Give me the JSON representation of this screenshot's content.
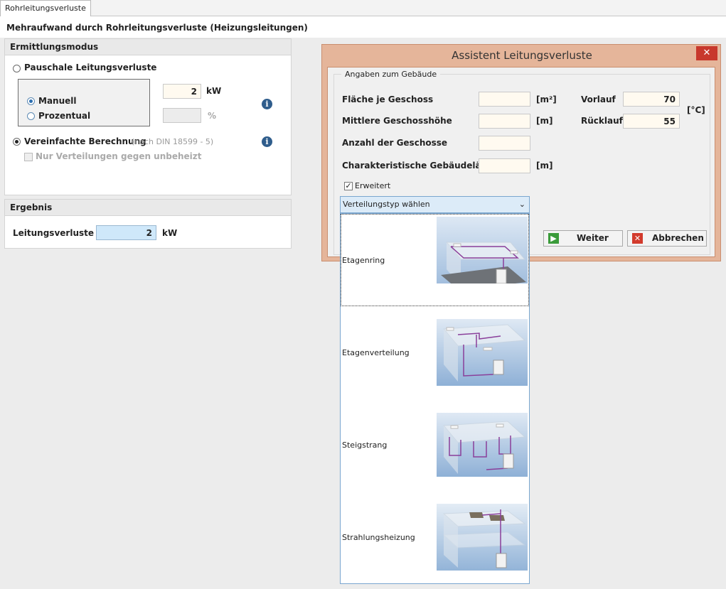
{
  "tab": {
    "label": "Rohrleitungsverluste"
  },
  "headline": "Mehraufwand durch Rohrleitungsverluste (Heizungsleitungen)",
  "mode_group": {
    "title": "Ermittlungsmodus",
    "pauschal_label": "Pauschale Leitungsverluste",
    "manuell_label": "Manuell",
    "prozentual_label": "Prozentual",
    "kw_value": "2",
    "kw_unit": "kW",
    "percent_value": "",
    "percent_unit": "%",
    "vereinfacht_label": "Vereinfachte Berechnung",
    "vereinfacht_note": "(nach DIN 18599 - 5)",
    "nur_verteilungen_label": "Nur Verteilungen gegen unbeheizt"
  },
  "result_group": {
    "title": "Ergebnis",
    "label": "Leitungsverluste",
    "value": "2",
    "unit": "kW"
  },
  "dialog": {
    "title": "Assistent Leitungsverluste",
    "close_glyph": "✕",
    "fieldset_title": "Angaben zum Gebäude",
    "flaeche_label": "Fläche je Geschoss",
    "flaeche_value": "",
    "flaeche_unit": "[m²]",
    "hoehe_label": "Mittlere Geschosshöhe",
    "hoehe_value": "",
    "hoehe_unit": "[m]",
    "anzahl_label": "Anzahl der Geschosse",
    "anzahl_value": "",
    "laenge_label": "Charakteristische Gebäudelänge",
    "laenge_value": "",
    "laenge_unit": "[m]",
    "vorlauf_label": "Vorlauf",
    "vorlauf_value": "70",
    "ruecklauf_label": "Rücklauf",
    "ruecklauf_value": "55",
    "temp_unit": "[°C]",
    "erweitert_label": "Erweitert",
    "erweitert_checked": true,
    "combo_text": "Verteilungstyp wählen",
    "weiter_label": "Weiter",
    "abbrechen_label": "Abbrechen"
  },
  "dropdown": {
    "options": [
      {
        "label": "Etagenring",
        "selected": true
      },
      {
        "label": "Etagenverteilung",
        "selected": false
      },
      {
        "label": "Steigstrang",
        "selected": false
      },
      {
        "label": "Strahlungsheizung",
        "selected": false
      }
    ]
  },
  "colors": {
    "dialog_frame": "#e5b59a",
    "close_button": "#c8382c",
    "info_icon": "#2f5d8c",
    "pipe": "#8a3f9a",
    "result_field": "#cfe8fa"
  }
}
